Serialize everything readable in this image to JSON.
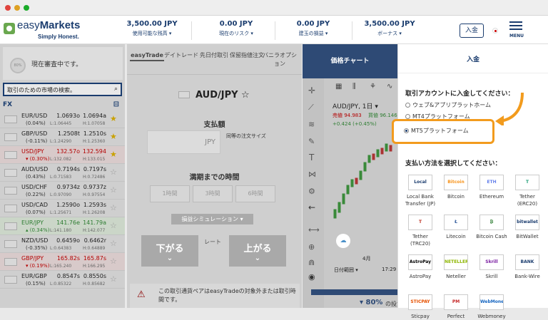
{
  "header": {
    "logo_text_light": "easy",
    "logo_text_bold": "Markets",
    "tagline": "Simply Honest.",
    "stats": [
      {
        "value": "3,500.00 JPY",
        "label": "使用可能な残高 ▾"
      },
      {
        "value": "0.00 JPY",
        "label": "現在のリスク ▾"
      },
      {
        "value": "0.00 JPY",
        "label": "建玉の損益 ▾"
      },
      {
        "value": "3,500.00 JPY",
        "label": "ボーナス ▾"
      }
    ],
    "deposit_btn": "入金",
    "menu_label": "MENU"
  },
  "sidebar": {
    "status": "現在審査中です。",
    "avatar": "80%",
    "search_placeholder": "取引のための市場の検索。",
    "section": "FX",
    "rows": [
      {
        "pair": "EUR/USD",
        "chg": "(0.04%)",
        "bid": "1.0693o",
        "ask": "1.0694a",
        "low": "L:1.06445",
        "high": "H:1.07058",
        "fav": true,
        "color": ""
      },
      {
        "pair": "GBP/USD",
        "chg": "(-0.11%)",
        "bid": "1.2508t",
        "ask": "1.2510s",
        "low": "L:1.24290",
        "high": "H:1.25360",
        "fav": true,
        "color": ""
      },
      {
        "pair": "USD/JPY",
        "chg": "▾ (0.30%)",
        "bid": "132.57o",
        "ask": "132.594",
        "low": "L:132.082",
        "high": "H:133.015",
        "fav": true,
        "color": "red"
      },
      {
        "pair": "AUD/USD",
        "chg": "(0.43%)",
        "bid": "0.7194s",
        "ask": "0.7197s",
        "low": "L:0.71583",
        "high": "H:0.72486",
        "fav": false,
        "color": ""
      },
      {
        "pair": "USD/CHF",
        "chg": "(0.22%)",
        "bid": "0.9734z",
        "ask": "0.9737z",
        "low": "L:0.97090",
        "high": "H:0.97554",
        "fav": false,
        "color": ""
      },
      {
        "pair": "USD/CAD",
        "chg": "(0.07%)",
        "bid": "1.2590o",
        "ask": "1.2593s",
        "low": "L:1.25671",
        "high": "H:1.26208",
        "fav": false,
        "color": ""
      },
      {
        "pair": "EUR/JPY",
        "chg": "▴ (0.34%)",
        "bid": "141.76e",
        "ask": "141.79a",
        "low": "L:141.180",
        "high": "H:142.077",
        "fav": false,
        "color": "grn"
      },
      {
        "pair": "NZD/USD",
        "chg": "(-0.35%)",
        "bid": "0.6459o",
        "ask": "0.6462r",
        "low": "L:0.64383",
        "high": "H:0.64889",
        "fav": false,
        "color": ""
      },
      {
        "pair": "GBP/JPY",
        "chg": "▾ (0.19%)",
        "bid": "165.82s",
        "ask": "165.87s",
        "low": "L:165.240",
        "high": "H:166.295",
        "fav": false,
        "color": "red"
      },
      {
        "pair": "EUR/GBP",
        "chg": "(0.15%)",
        "bid": "0.8547s",
        "ask": "0.8550s",
        "low": "L:0.85322",
        "high": "H:0.85682",
        "fav": false,
        "color": ""
      }
    ]
  },
  "mid": {
    "tabs": [
      "easyTrade",
      "デイトレード",
      "先日付取引",
      "保留指値注文",
      "バニラオプション"
    ],
    "pair": "AUD/JPY ☆",
    "amount_label": "支払額",
    "currency": "JPY",
    "same_size": "同等の注文サイズ",
    "time_label": "満期までの時間",
    "times": [
      "1時間",
      "3時間",
      "6時間"
    ],
    "sim": "損益シミュレーション ▾",
    "rate": "レート",
    "down": "下がる",
    "up": "上がる",
    "notice": "この取引通貨ペアはeasyTradeの対象外または取引時間です。"
  },
  "chartpane": {
    "tab": "価格チャート",
    "sym": "AUD/JPY, 1日 ▾",
    "sell": "売値 94.983",
    "buy": "買値 96.146",
    "chg": "+0.424 (+0.45%)",
    "month": "4月",
    "range": "日付範囲 ▾",
    "time": "17:29",
    "pct": "▾ 80%",
    "pct_suffix": "の投資"
  },
  "panel": {
    "title": "入金",
    "q1": "取引アカウントに入金してください：",
    "opt1": "ウェブ&アプリプラットホーム",
    "opt2": "MT4プラットフォーム",
    "opt3": "MT5プラットフォーム",
    "q2": "支払い方法を選択してください：",
    "methods": [
      {
        "icon": "Local Bank",
        "name": "Local Bank Transfer (JP)"
      },
      {
        "icon": "Bitcoin",
        "name": "Bitcoin"
      },
      {
        "icon": "ETH",
        "name": "Ethereum"
      },
      {
        "icon": "T",
        "name": "Tether (ERC20)"
      },
      {
        "icon": "T",
        "name": "Tether (TRC20)"
      },
      {
        "icon": "Ł",
        "name": "Litecoin"
      },
      {
        "icon": "₿",
        "name": "Bitcoin Cash"
      },
      {
        "icon": "bitwallet",
        "name": "BitWallet"
      },
      {
        "icon": "AstroPay",
        "name": "AstroPay"
      },
      {
        "icon": "NETELLER",
        "name": "Neteller"
      },
      {
        "icon": "Skrill",
        "name": "Skrill"
      },
      {
        "icon": "BANK",
        "name": "Bank-Wire"
      },
      {
        "icon": "STICPAY",
        "name": "Sticpay"
      },
      {
        "icon": "PM",
        "name": "Perfect"
      },
      {
        "icon": "WebMoney",
        "name": "Webmoney"
      }
    ]
  },
  "colors": {
    "brand": "#1a3c6e",
    "accent": "#f29b1d",
    "up": "#2e7d32",
    "down": "#b30000"
  }
}
